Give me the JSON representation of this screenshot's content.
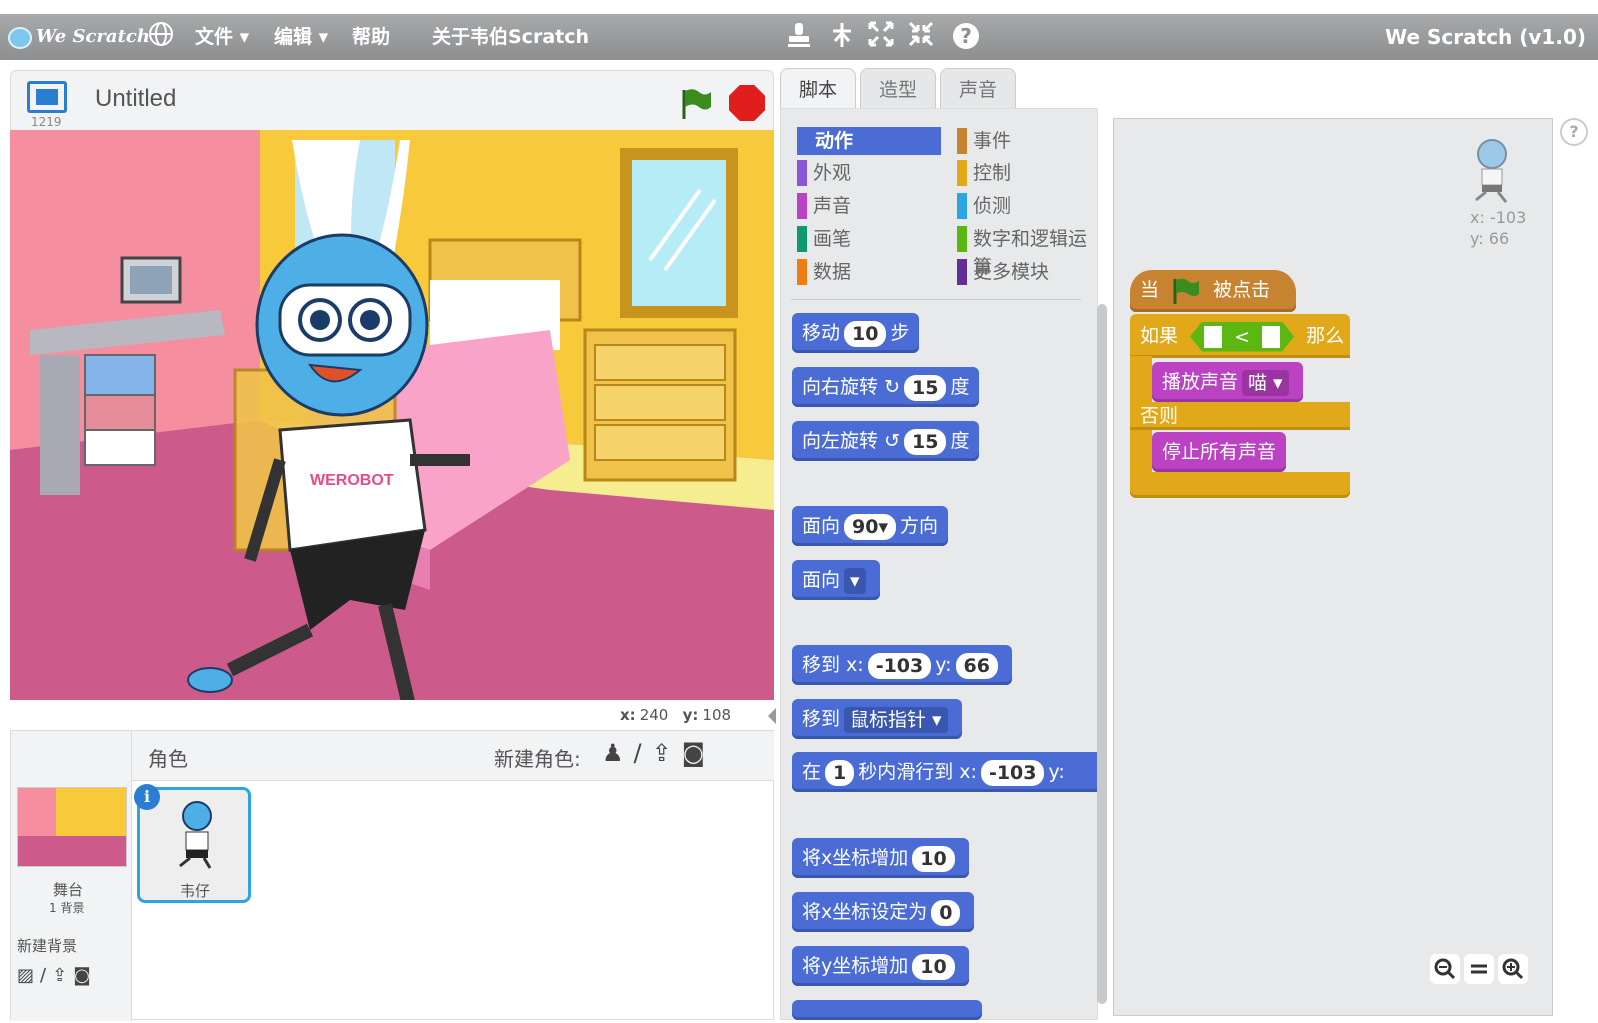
{
  "menu": {
    "logo": "We Scratch",
    "file": "文件 ▾",
    "edit": "编辑 ▾",
    "help": "帮助",
    "about": "关于韦伯Scratch",
    "app_title": "We Scratch (v1.0)"
  },
  "stage": {
    "title": "Untitled",
    "version_num": "1219",
    "coord_x_label": "x:",
    "coord_x": "240",
    "coord_y_label": "y:",
    "coord_y": "108"
  },
  "sprites": {
    "header": "角色",
    "new_sprite": "新建角色:",
    "stage_label": "舞台",
    "backdrop_count": "1 背景",
    "new_backdrop": "新建背景",
    "sprite_name": "韦仔",
    "shirt_text": "WEROBOT"
  },
  "tabs": [
    "脚本",
    "造型",
    "声音"
  ],
  "categories": [
    {
      "label": "动作",
      "color": "#4a6cd4"
    },
    {
      "label": "外观",
      "color": "#8a55d7"
    },
    {
      "label": "声音",
      "color": "#bb42c3"
    },
    {
      "label": "画笔",
      "color": "#0e9a6c"
    },
    {
      "label": "数据",
      "color": "#ee7d16"
    },
    {
      "label": "事件",
      "color": "#c88330"
    },
    {
      "label": "控制",
      "color": "#e1a91a"
    },
    {
      "label": "侦测",
      "color": "#2ca5e2"
    },
    {
      "label": "数字和逻辑运算",
      "color": "#5cb712"
    },
    {
      "label": "更多模块",
      "color": "#632d99"
    }
  ],
  "blocks": {
    "move": {
      "a": "移动",
      "v": "10",
      "b": "步"
    },
    "turn_right": {
      "a": "向右旋转",
      "icon": "↻",
      "v": "15",
      "b": "度"
    },
    "turn_left": {
      "a": "向左旋转",
      "icon": "↺",
      "v": "15",
      "b": "度"
    },
    "point_dir": {
      "a": "面向",
      "v": "90▾",
      "b": "方向"
    },
    "point_to": {
      "a": "面向",
      "dd": "▾"
    },
    "goto_xy": {
      "a": "移到 x:",
      "x": "-103",
      "ylab": "y:",
      "y": "66"
    },
    "goto": {
      "a": "移到",
      "dd": "鼠标指针 ▾"
    },
    "glide": {
      "a": "在",
      "v": "1",
      "b": "秒内滑行到 x:",
      "x": "-103",
      "ylab": "y:"
    },
    "change_x": {
      "a": "将x坐标增加",
      "v": "10"
    },
    "set_x": {
      "a": "将x坐标设定为",
      "v": "0"
    },
    "change_y": {
      "a": "将y坐标增加",
      "v": "10"
    }
  },
  "script": {
    "when": "当",
    "clicked": "被点击",
    "if": "如果",
    "lt": "<",
    "then": "那么",
    "play": "播放声音",
    "sound": "喵 ▾",
    "else": "否则",
    "stop_all": "停止所有声音"
  },
  "sprite_pos": {
    "x_label": "x:",
    "x": "-103",
    "y_label": "y:",
    "y": "66"
  },
  "help_q": "?"
}
